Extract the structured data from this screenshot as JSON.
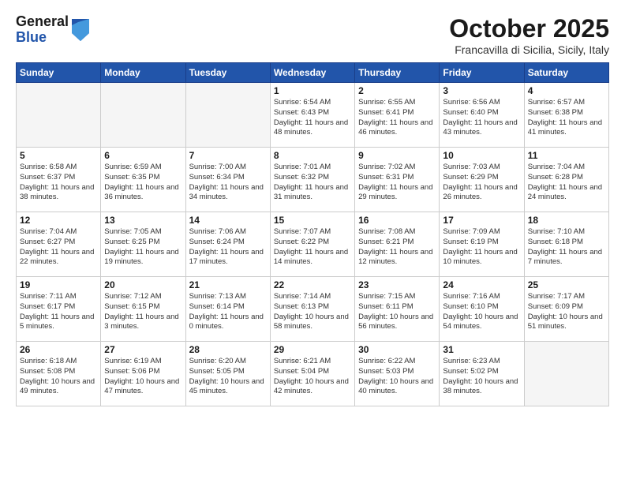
{
  "header": {
    "logo_general": "General",
    "logo_blue": "Blue",
    "month_title": "October 2025",
    "location": "Francavilla di Sicilia, Sicily, Italy"
  },
  "weekdays": [
    "Sunday",
    "Monday",
    "Tuesday",
    "Wednesday",
    "Thursday",
    "Friday",
    "Saturday"
  ],
  "weeks": [
    [
      {
        "day": "",
        "sunrise": "",
        "sunset": "",
        "daylight": "",
        "empty": true
      },
      {
        "day": "",
        "sunrise": "",
        "sunset": "",
        "daylight": "",
        "empty": true
      },
      {
        "day": "",
        "sunrise": "",
        "sunset": "",
        "daylight": "",
        "empty": true
      },
      {
        "day": "1",
        "sunrise": "Sunrise: 6:54 AM",
        "sunset": "Sunset: 6:43 PM",
        "daylight": "Daylight: 11 hours and 48 minutes.",
        "empty": false
      },
      {
        "day": "2",
        "sunrise": "Sunrise: 6:55 AM",
        "sunset": "Sunset: 6:41 PM",
        "daylight": "Daylight: 11 hours and 46 minutes.",
        "empty": false
      },
      {
        "day": "3",
        "sunrise": "Sunrise: 6:56 AM",
        "sunset": "Sunset: 6:40 PM",
        "daylight": "Daylight: 11 hours and 43 minutes.",
        "empty": false
      },
      {
        "day": "4",
        "sunrise": "Sunrise: 6:57 AM",
        "sunset": "Sunset: 6:38 PM",
        "daylight": "Daylight: 11 hours and 41 minutes.",
        "empty": false
      }
    ],
    [
      {
        "day": "5",
        "sunrise": "Sunrise: 6:58 AM",
        "sunset": "Sunset: 6:37 PM",
        "daylight": "Daylight: 11 hours and 38 minutes.",
        "empty": false
      },
      {
        "day": "6",
        "sunrise": "Sunrise: 6:59 AM",
        "sunset": "Sunset: 6:35 PM",
        "daylight": "Daylight: 11 hours and 36 minutes.",
        "empty": false
      },
      {
        "day": "7",
        "sunrise": "Sunrise: 7:00 AM",
        "sunset": "Sunset: 6:34 PM",
        "daylight": "Daylight: 11 hours and 34 minutes.",
        "empty": false
      },
      {
        "day": "8",
        "sunrise": "Sunrise: 7:01 AM",
        "sunset": "Sunset: 6:32 PM",
        "daylight": "Daylight: 11 hours and 31 minutes.",
        "empty": false
      },
      {
        "day": "9",
        "sunrise": "Sunrise: 7:02 AM",
        "sunset": "Sunset: 6:31 PM",
        "daylight": "Daylight: 11 hours and 29 minutes.",
        "empty": false
      },
      {
        "day": "10",
        "sunrise": "Sunrise: 7:03 AM",
        "sunset": "Sunset: 6:29 PM",
        "daylight": "Daylight: 11 hours and 26 minutes.",
        "empty": false
      },
      {
        "day": "11",
        "sunrise": "Sunrise: 7:04 AM",
        "sunset": "Sunset: 6:28 PM",
        "daylight": "Daylight: 11 hours and 24 minutes.",
        "empty": false
      }
    ],
    [
      {
        "day": "12",
        "sunrise": "Sunrise: 7:04 AM",
        "sunset": "Sunset: 6:27 PM",
        "daylight": "Daylight: 11 hours and 22 minutes.",
        "empty": false
      },
      {
        "day": "13",
        "sunrise": "Sunrise: 7:05 AM",
        "sunset": "Sunset: 6:25 PM",
        "daylight": "Daylight: 11 hours and 19 minutes.",
        "empty": false
      },
      {
        "day": "14",
        "sunrise": "Sunrise: 7:06 AM",
        "sunset": "Sunset: 6:24 PM",
        "daylight": "Daylight: 11 hours and 17 minutes.",
        "empty": false
      },
      {
        "day": "15",
        "sunrise": "Sunrise: 7:07 AM",
        "sunset": "Sunset: 6:22 PM",
        "daylight": "Daylight: 11 hours and 14 minutes.",
        "empty": false
      },
      {
        "day": "16",
        "sunrise": "Sunrise: 7:08 AM",
        "sunset": "Sunset: 6:21 PM",
        "daylight": "Daylight: 11 hours and 12 minutes.",
        "empty": false
      },
      {
        "day": "17",
        "sunrise": "Sunrise: 7:09 AM",
        "sunset": "Sunset: 6:19 PM",
        "daylight": "Daylight: 11 hours and 10 minutes.",
        "empty": false
      },
      {
        "day": "18",
        "sunrise": "Sunrise: 7:10 AM",
        "sunset": "Sunset: 6:18 PM",
        "daylight": "Daylight: 11 hours and 7 minutes.",
        "empty": false
      }
    ],
    [
      {
        "day": "19",
        "sunrise": "Sunrise: 7:11 AM",
        "sunset": "Sunset: 6:17 PM",
        "daylight": "Daylight: 11 hours and 5 minutes.",
        "empty": false
      },
      {
        "day": "20",
        "sunrise": "Sunrise: 7:12 AM",
        "sunset": "Sunset: 6:15 PM",
        "daylight": "Daylight: 11 hours and 3 minutes.",
        "empty": false
      },
      {
        "day": "21",
        "sunrise": "Sunrise: 7:13 AM",
        "sunset": "Sunset: 6:14 PM",
        "daylight": "Daylight: 11 hours and 0 minutes.",
        "empty": false
      },
      {
        "day": "22",
        "sunrise": "Sunrise: 7:14 AM",
        "sunset": "Sunset: 6:13 PM",
        "daylight": "Daylight: 10 hours and 58 minutes.",
        "empty": false
      },
      {
        "day": "23",
        "sunrise": "Sunrise: 7:15 AM",
        "sunset": "Sunset: 6:11 PM",
        "daylight": "Daylight: 10 hours and 56 minutes.",
        "empty": false
      },
      {
        "day": "24",
        "sunrise": "Sunrise: 7:16 AM",
        "sunset": "Sunset: 6:10 PM",
        "daylight": "Daylight: 10 hours and 54 minutes.",
        "empty": false
      },
      {
        "day": "25",
        "sunrise": "Sunrise: 7:17 AM",
        "sunset": "Sunset: 6:09 PM",
        "daylight": "Daylight: 10 hours and 51 minutes.",
        "empty": false
      }
    ],
    [
      {
        "day": "26",
        "sunrise": "Sunrise: 6:18 AM",
        "sunset": "Sunset: 5:08 PM",
        "daylight": "Daylight: 10 hours and 49 minutes.",
        "empty": false
      },
      {
        "day": "27",
        "sunrise": "Sunrise: 6:19 AM",
        "sunset": "Sunset: 5:06 PM",
        "daylight": "Daylight: 10 hours and 47 minutes.",
        "empty": false
      },
      {
        "day": "28",
        "sunrise": "Sunrise: 6:20 AM",
        "sunset": "Sunset: 5:05 PM",
        "daylight": "Daylight: 10 hours and 45 minutes.",
        "empty": false
      },
      {
        "day": "29",
        "sunrise": "Sunrise: 6:21 AM",
        "sunset": "Sunset: 5:04 PM",
        "daylight": "Daylight: 10 hours and 42 minutes.",
        "empty": false
      },
      {
        "day": "30",
        "sunrise": "Sunrise: 6:22 AM",
        "sunset": "Sunset: 5:03 PM",
        "daylight": "Daylight: 10 hours and 40 minutes.",
        "empty": false
      },
      {
        "day": "31",
        "sunrise": "Sunrise: 6:23 AM",
        "sunset": "Sunset: 5:02 PM",
        "daylight": "Daylight: 10 hours and 38 minutes.",
        "empty": false
      },
      {
        "day": "",
        "sunrise": "",
        "sunset": "",
        "daylight": "",
        "empty": true
      }
    ]
  ]
}
